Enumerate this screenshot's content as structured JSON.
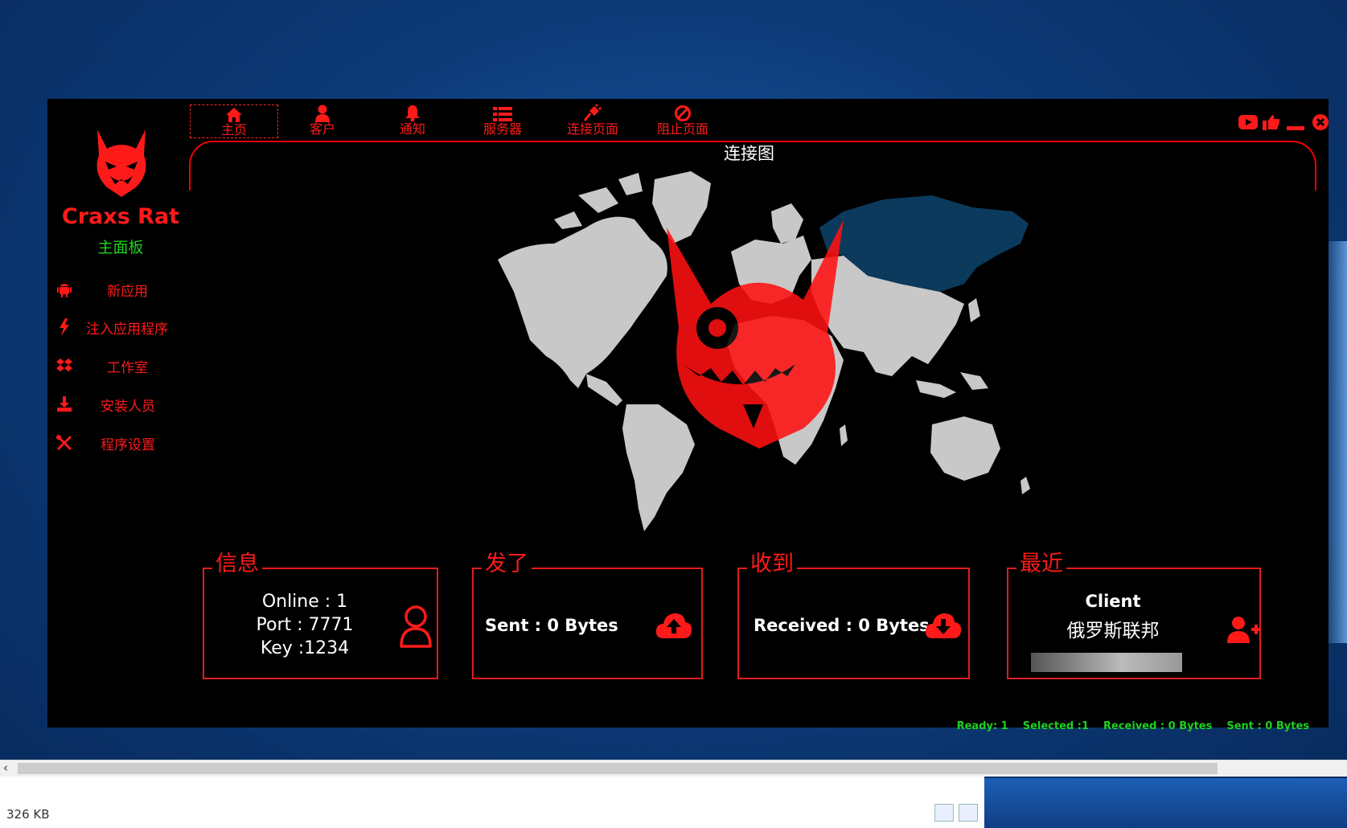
{
  "app": {
    "title": "Craxs Rat",
    "subtitle": "主面板"
  },
  "sidebar": {
    "items": [
      {
        "label": "新应用",
        "icon": "android-icon"
      },
      {
        "label": "注入应用程序",
        "icon": "bolt-icon"
      },
      {
        "label": "工作室",
        "icon": "dropbox-icon"
      },
      {
        "label": "安装人员",
        "icon": "download-icon"
      },
      {
        "label": "程序设置",
        "icon": "tools-icon"
      }
    ]
  },
  "tabs": [
    {
      "label": "主页",
      "icon": "home-icon",
      "active": true
    },
    {
      "label": "客户",
      "icon": "user-icon"
    },
    {
      "label": "通知",
      "icon": "bell-icon"
    },
    {
      "label": "服务器",
      "icon": "list-icon"
    },
    {
      "label": "连接页面",
      "icon": "plug-icon"
    },
    {
      "label": "阻止页面",
      "icon": "ban-icon"
    }
  ],
  "map": {
    "title": "连接图"
  },
  "panels": {
    "info": {
      "title": "信息",
      "online": "Online : 1",
      "port": "Port : 7771",
      "key": "Key :1234"
    },
    "sent": {
      "title": "发了",
      "text": "Sent : 0 Bytes"
    },
    "received": {
      "title": "收到",
      "text": "Received : 0 Bytes"
    },
    "recent": {
      "title": "最近",
      "client": "Client",
      "country": "俄罗斯联邦"
    }
  },
  "status": {
    "ready": "Ready: 1",
    "selected": "Selected :1",
    "received": "Received : 0 Bytes",
    "sent": "Sent : 0 Bytes"
  },
  "explorer": {
    "file_size": "326 KB"
  },
  "colors": {
    "accent": "#ff1a1a",
    "status_green": "#1fd11f",
    "background": "#000000",
    "map_land": "#c8c8c8",
    "map_highlight": "#0b3a5c"
  }
}
